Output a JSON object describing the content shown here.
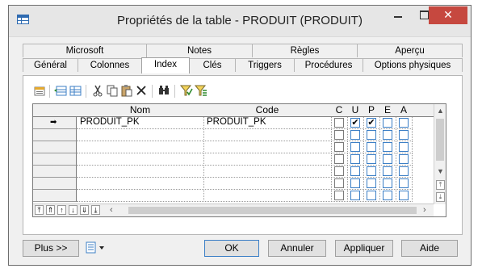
{
  "window": {
    "title": "Propriétés de la table - PRODUIT (PRODUIT)"
  },
  "tabs_back": [
    "Microsoft",
    "Notes",
    "Règles",
    "Aperçu"
  ],
  "tabs_front": [
    "Général",
    "Colonnes",
    "Index",
    "Clés",
    "Triggers",
    "Procédures",
    "Options physiques"
  ],
  "active_tab": "Index",
  "toolbar_icons": [
    "properties-icon",
    "add-row-icon",
    "insert-row-icon",
    "cut-icon",
    "copy-icon",
    "paste-icon",
    "delete-icon",
    "find-icon",
    "filter-icon",
    "clear-filter-icon"
  ],
  "grid": {
    "headers": {
      "nom": "Nom",
      "code": "Code",
      "c": "C",
      "u": "U",
      "p": "P",
      "e": "E",
      "a": "A"
    },
    "rows": [
      {
        "nom": "PRODUIT_PK",
        "code": "PRODUIT_PK",
        "c": false,
        "u": true,
        "p": true,
        "e": false,
        "a": false,
        "current": true,
        "marker": "➡"
      }
    ],
    "empty_rows": 6
  },
  "buttons": {
    "more": "Plus >>",
    "ok": "OK",
    "cancel": "Annuler",
    "apply": "Appliquer",
    "help": "Aide"
  }
}
